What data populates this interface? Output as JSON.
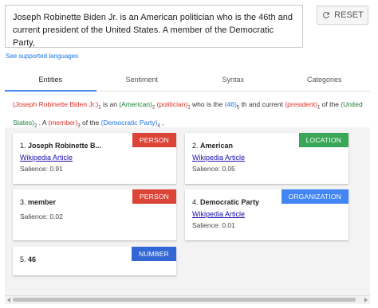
{
  "input": {
    "text": "Joseph Robinette Biden Jr. is an American politician who is the 46th and current president of the United States. A member of the Democratic Party,"
  },
  "reset_label": "RESET",
  "supported_languages_link": "See supported languages",
  "tabs": [
    {
      "label": "Entities"
    },
    {
      "label": "Sentiment"
    },
    {
      "label": "Syntax"
    },
    {
      "label": "Categories"
    }
  ],
  "annotated": {
    "e1": "(Joseph Robinette Biden Jr.)",
    "s1": "1",
    "t1": " is an ",
    "e2": "(American)",
    "s2": "2",
    "t2": " ",
    "e3": "(politician)",
    "s3": "1",
    "t3": " who is the ",
    "e4": "(46)",
    "s4": "5",
    "t4": " th and current ",
    "e5": "(president)",
    "s5": "1",
    "t5": " of the ",
    "e6": "(United States)",
    "s6": "2",
    "t6": " . A ",
    "e7": "(member)",
    "s7": "3",
    "t7": " of the ",
    "e8": "(Democratic Party)",
    "s8": "4",
    "t8": " ,"
  },
  "entities": [
    {
      "index": "1.",
      "name": "Joseph Robinette B...",
      "link": "Wikipedia Article",
      "salience": "Salience: 0.91",
      "type": "PERSON"
    },
    {
      "index": "2.",
      "name": "American",
      "link": "Wikipedia Article",
      "salience": "Salience: 0.05",
      "type": "LOCATION"
    },
    {
      "index": "3.",
      "name": "member",
      "link": "",
      "salience": "Salience: 0.02",
      "type": "PERSON"
    },
    {
      "index": "4.",
      "name": "Democratic Party",
      "link": "Wikipedia Article",
      "salience": "Salience: 0.01",
      "type": "ORGANIZATION"
    },
    {
      "index": "5.",
      "name": "46",
      "link": "",
      "salience": "",
      "type": "NUMBER"
    }
  ],
  "colors": {
    "person": "#db4437",
    "location": "#3aa757",
    "organization": "#4285f4",
    "number": "#3367d6",
    "accent": "#4285f4"
  }
}
